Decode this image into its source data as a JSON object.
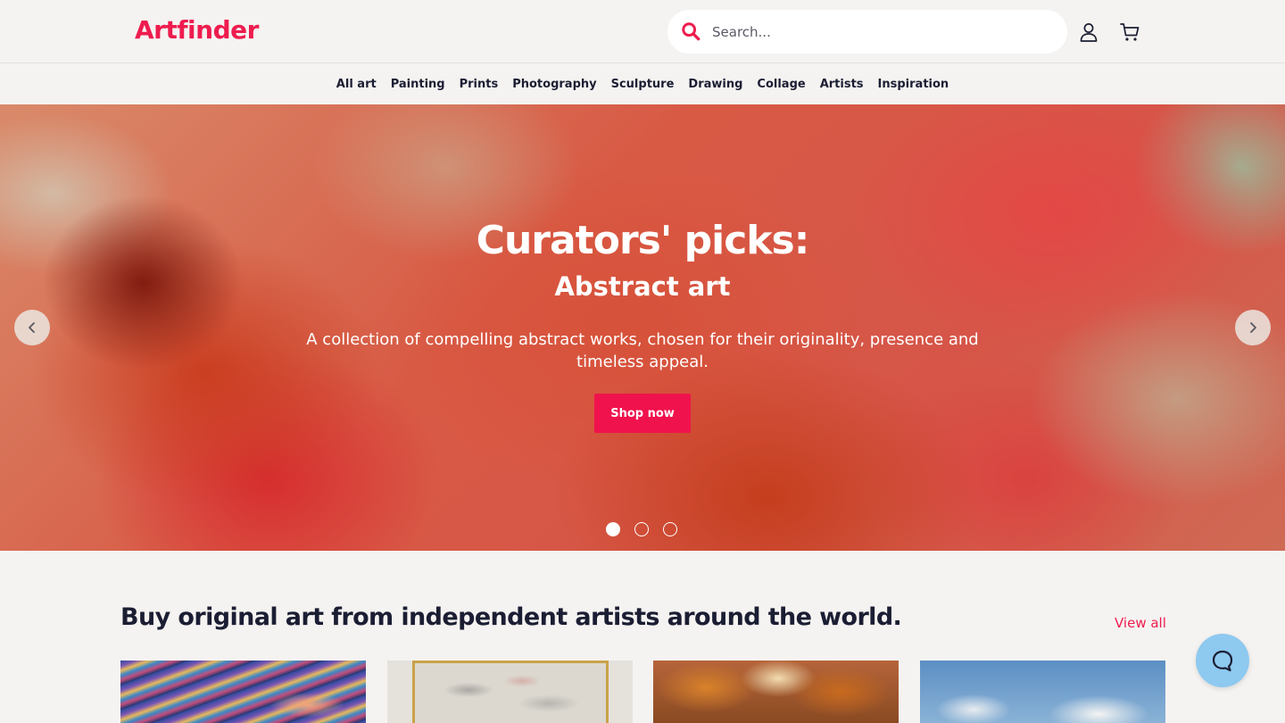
{
  "header": {
    "logo": "Artfinder",
    "search": {
      "placeholder": "Search...",
      "icon": "search-icon"
    },
    "icons": [
      "user-icon",
      "cart-icon"
    ]
  },
  "nav": {
    "items": [
      "All art",
      "Painting",
      "Prints",
      "Photography",
      "Sculpture",
      "Drawing",
      "Collage",
      "Artists",
      "Inspiration"
    ]
  },
  "hero": {
    "title": "Curators' picks:",
    "subtitle": "Abstract art",
    "description": "A collection of compelling abstract works, chosen for their originality, presence and timeless appeal.",
    "cta": "Shop now",
    "slides_total": 3,
    "active_slide": 1
  },
  "section": {
    "title": "Buy original art from independent artists around the world.",
    "view_all": "View all"
  },
  "colors": {
    "brand": "#ee1c4e",
    "text": "#1b1e33",
    "background": "#f5f3f1",
    "help_button": "#8ec9f0"
  }
}
